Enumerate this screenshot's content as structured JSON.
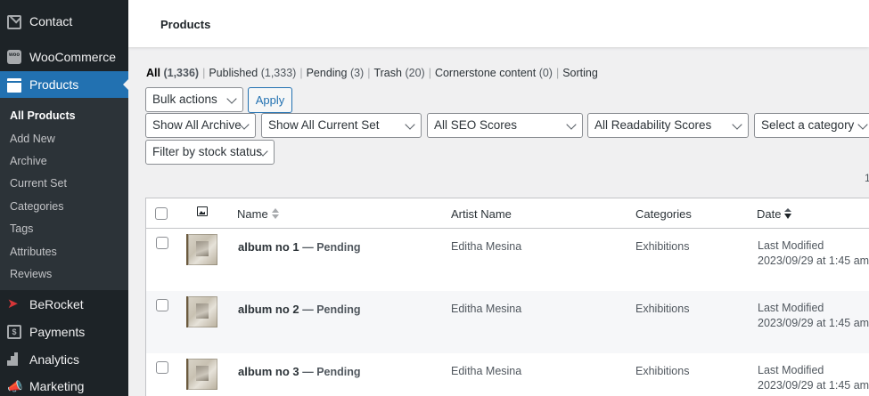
{
  "sidebar": {
    "items": [
      {
        "label": "Contact",
        "icon": "mail-icon"
      },
      {
        "label": "WooCommerce",
        "icon": "woocommerce-icon"
      },
      {
        "label": "Products",
        "icon": "products-icon"
      },
      {
        "label": "BeRocket",
        "icon": "rocket-icon"
      },
      {
        "label": "Payments",
        "icon": "payments-icon"
      },
      {
        "label": "Analytics",
        "icon": "analytics-icon"
      },
      {
        "label": "Marketing",
        "icon": "megaphone-icon"
      }
    ],
    "submenu": [
      "All Products",
      "Add New",
      "Archive",
      "Current Set",
      "Categories",
      "Tags",
      "Attributes",
      "Reviews"
    ]
  },
  "header": {
    "title": "Products"
  },
  "status_links": [
    {
      "label": "All",
      "count": "(1,336)"
    },
    {
      "label": "Published",
      "count": "(1,333)"
    },
    {
      "label": "Pending",
      "count": "(3)"
    },
    {
      "label": "Trash",
      "count": "(20)"
    },
    {
      "label": "Cornerstone content",
      "count": "(0)"
    },
    {
      "label": "Sorting",
      "count": ""
    }
  ],
  "filters": {
    "bulk_actions": "Bulk actions",
    "apply": "Apply",
    "archive": "Show All Archive",
    "current_set": "Show All Current Set",
    "seo": "All SEO Scores",
    "readability": "All Readability Scores",
    "category": "Select a category",
    "stock": "Filter by stock status"
  },
  "pagination": {
    "partial": "1"
  },
  "table": {
    "columns": {
      "name": "Name",
      "artist": "Artist Name",
      "categories": "Categories",
      "date": "Date"
    },
    "rows": [
      {
        "name": "album no 1",
        "state": "— Pending",
        "artist": "Editha Mesina",
        "category": "Exhibitions",
        "date_label": "Last Modified",
        "date": "2023/09/29 at 1:45 am"
      },
      {
        "name": "album no 2",
        "state": "— Pending",
        "artist": "Editha Mesina",
        "category": "Exhibitions",
        "date_label": "Last Modified",
        "date": "2023/09/29 at 1:45 am"
      },
      {
        "name": "album no 3",
        "state": "— Pending",
        "artist": "Editha Mesina",
        "category": "Exhibitions",
        "date_label": "Last Modified",
        "date": "2023/09/29 at 1:45 am"
      }
    ]
  },
  "colors": {
    "sidebar_bg": "#1d2327",
    "active": "#2271b1",
    "submenu_bg": "#2c3338"
  }
}
